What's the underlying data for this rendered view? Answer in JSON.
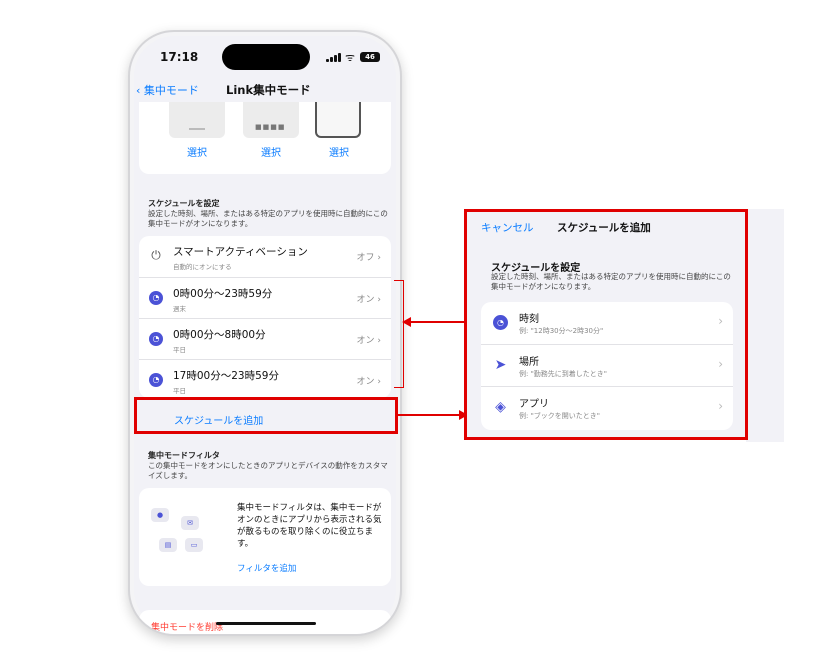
{
  "phone": {
    "status": {
      "time": "17:18",
      "battery": "46"
    },
    "nav": {
      "back_label": "集中モード",
      "title": "Link集中モード"
    },
    "wallpaper": {
      "select_labels": [
        "選択",
        "選択",
        "選択"
      ]
    },
    "schedule_section": {
      "title": "スケジュールを設定",
      "description": "設定した時刻、場所、またはある特定のアプリを使用時に自動的にこの集中モードがオンになります。",
      "rows": [
        {
          "icon": "power-icon",
          "main": "スマートアクティベーション",
          "sub": "自動的にオンにする",
          "state": "オフ"
        },
        {
          "icon": "clock-icon",
          "main": "0時00分〜23時59分",
          "sub": "週末",
          "state": "オン"
        },
        {
          "icon": "clock-icon",
          "main": "0時00分〜8時00分",
          "sub": "平日",
          "state": "オン"
        },
        {
          "icon": "clock-icon",
          "main": "17時00分〜23時59分",
          "sub": "平日",
          "state": "オン"
        }
      ],
      "add_label": "スケジュールを追加"
    },
    "filter_section": {
      "title": "集中モードフィルタ",
      "description": "この集中モードをオンにしたときのアプリとデバイスの動作をカスタマイズします。",
      "body": "集中モードフィルタは、集中モードがオンのときにアプリから表示される気が散るものを取り除くのに役立ちます。",
      "link": "フィルタを追加"
    },
    "delete_label": "集中モードを削除"
  },
  "popup": {
    "cancel_label": "キャンセル",
    "title": "スケジュールを追加",
    "section_title": "スケジュールを設定",
    "section_desc": "設定した時刻、場所、またはある特定のアプリを使用時に自動的にこの集中モードがオンになります。",
    "rows": [
      {
        "icon": "clock-icon",
        "main": "時刻",
        "sub": "例: \"12時30分〜2時30分\""
      },
      {
        "icon": "location-arrow-icon",
        "main": "場所",
        "sub": "例: \"勤務先に到着したとき\""
      },
      {
        "icon": "layers-icon",
        "main": "アプリ",
        "sub": "例: \"ブックを開いたとき\""
      }
    ]
  },
  "colors": {
    "accent": "#0a7cff",
    "highlight": "#e00000",
    "icon": "#4b52d6",
    "destructive": "#ff3b30"
  }
}
